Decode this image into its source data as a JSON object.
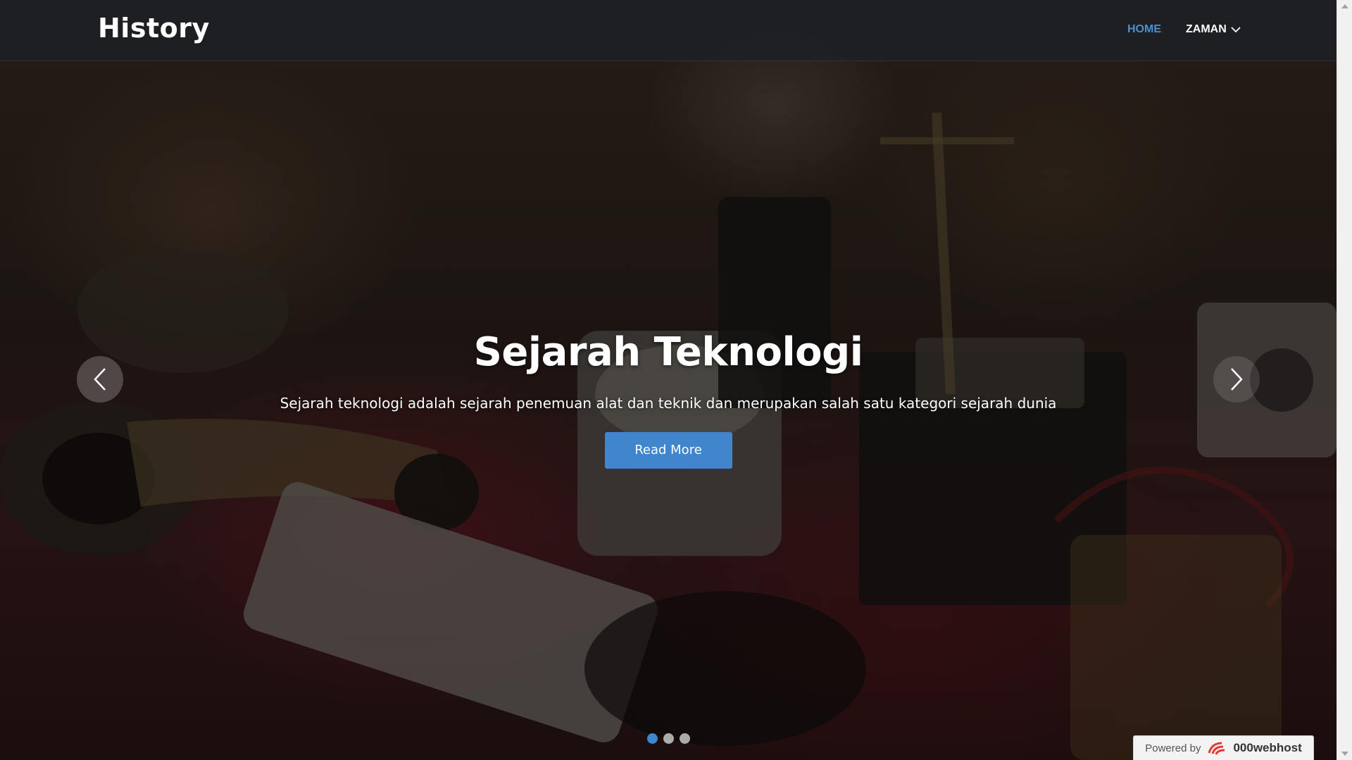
{
  "navbar": {
    "brand": "History",
    "links": [
      {
        "label": "HOME",
        "active": true
      },
      {
        "label": "ZAMAN",
        "has_dropdown": true
      }
    ]
  },
  "slide": {
    "title": "Sejarah Teknologi",
    "description": "Sejarah teknologi adalah sejarah penemuan alat dan teknik dan merupakan salah satu kategori sejarah dunia",
    "button_label": "Read More"
  },
  "carousel": {
    "prev_icon": "chevron-left-icon",
    "next_icon": "chevron-right-icon",
    "slide_count": 3,
    "active_index": 0
  },
  "badge": {
    "prefix": "Powered by",
    "brand": "000webhost"
  },
  "colors": {
    "accent": "#3f86cc",
    "nav_active": "#4a90d0",
    "navbar_bg": "#1e2024"
  }
}
